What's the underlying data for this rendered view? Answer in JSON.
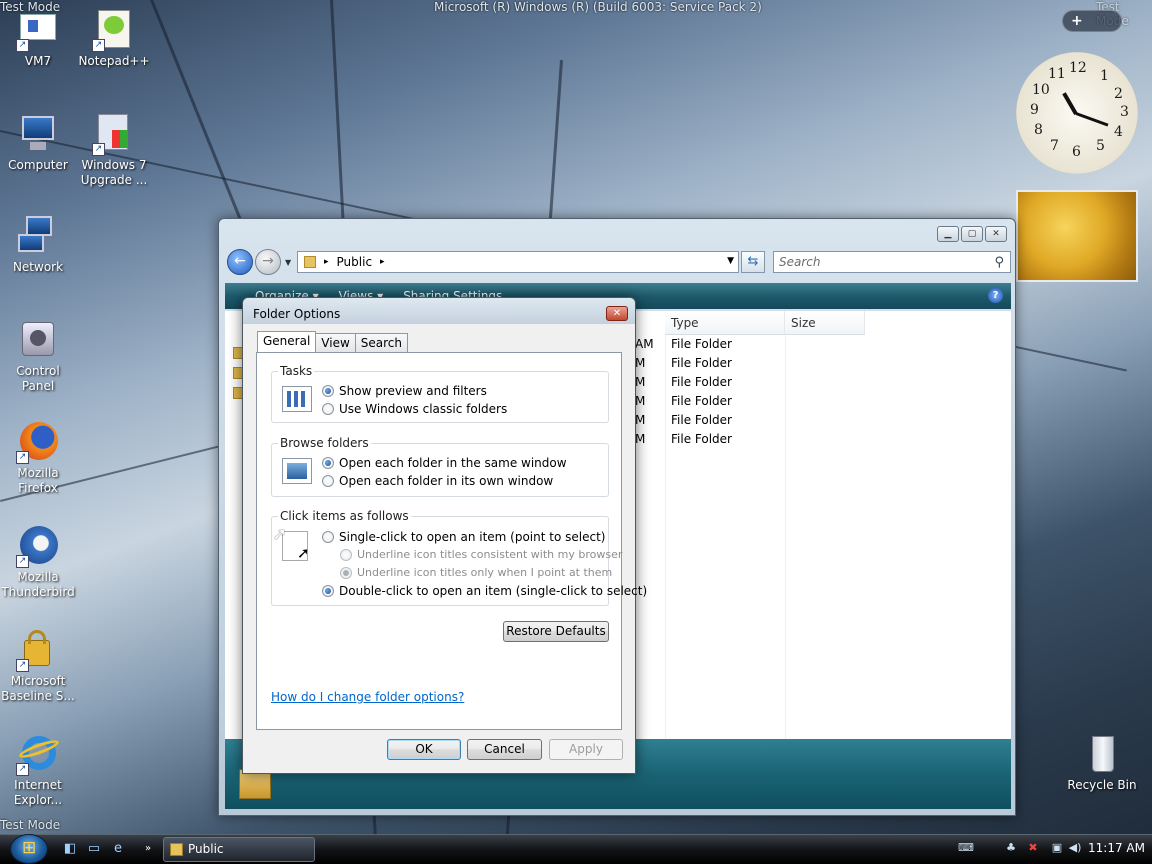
{
  "desktop": {
    "top_left_watermark": "Test Mode",
    "top_right_watermark": "Test Mode",
    "bottom_left_watermark": "Test Mode",
    "build_text": "Microsoft (R) Windows (R) (Build 6003: Service Pack 2)",
    "icons": [
      {
        "label": "VM7",
        "icon": "vm-shortcut-icon"
      },
      {
        "label": "Notepad++",
        "icon": "notepad-plus-plus-icon"
      },
      {
        "label": "Computer",
        "icon": "computer-icon"
      },
      {
        "label": "Windows 7 Upgrade ...",
        "icon": "windows-upgrade-icon"
      },
      {
        "label": "Network",
        "icon": "network-icon"
      },
      {
        "label": "Control Panel",
        "icon": "control-panel-icon"
      },
      {
        "label": "Mozilla Firefox",
        "icon": "firefox-icon"
      },
      {
        "label": "Mozilla Thunderbird",
        "icon": "thunderbird-icon"
      },
      {
        "label": "Microsoft Baseline S...",
        "icon": "baseline-analyzer-icon"
      },
      {
        "label": "Internet Explor...",
        "icon": "internet-explorer-icon"
      },
      {
        "label": "Recycle Bin",
        "icon": "recycle-bin-icon"
      }
    ]
  },
  "explorer": {
    "address": {
      "location": "Public",
      "separator": "▸"
    },
    "search_placeholder": "Search",
    "toolbar": {
      "organize": "Organize ▾",
      "views": "Views ▾",
      "sharing": "Sharing Settings"
    },
    "columns": {
      "type": "Type",
      "size": "Size"
    },
    "rows": [
      {
        "date_tail": "AM",
        "type": "File Folder"
      },
      {
        "date_tail": "M",
        "type": "File Folder"
      },
      {
        "date_tail": "M",
        "type": "File Folder"
      },
      {
        "date_tail": "M",
        "type": "File Folder"
      },
      {
        "date_tail": "M",
        "type": "File Folder"
      },
      {
        "date_tail": "M",
        "type": "File Folder"
      }
    ]
  },
  "dialog": {
    "title": "Folder Options",
    "tabs": [
      "General",
      "View",
      "Search"
    ],
    "active_tab": "General",
    "tasks": {
      "title": "Tasks",
      "opt1": "Show preview and filters",
      "opt2": "Use Windows classic folders"
    },
    "browse": {
      "title": "Browse folders",
      "opt1": "Open each folder in the same window",
      "opt2": "Open each folder in its own window"
    },
    "click": {
      "title": "Click items as follows",
      "opt1": "Single-click to open an item (point to select)",
      "sub1": "Underline icon titles consistent with my browser",
      "sub2": "Underline icon titles only when I point at them",
      "opt2": "Double-click to open an item (single-click to select)"
    },
    "restore_defaults": "Restore Defaults",
    "help_link": "How do I change folder options?",
    "ok": "OK",
    "cancel": "Cancel",
    "apply": "Apply"
  },
  "taskbar": {
    "task_label": "Public",
    "time": "11:17 AM"
  },
  "clock": {
    "numbers": [
      "12",
      "1",
      "2",
      "3",
      "4",
      "5",
      "6",
      "7",
      "8",
      "9",
      "10",
      "11"
    ]
  },
  "colors": {
    "toolbar": "#1d5a6c",
    "link": "#0066cc",
    "selection": "#1b4f9a"
  }
}
